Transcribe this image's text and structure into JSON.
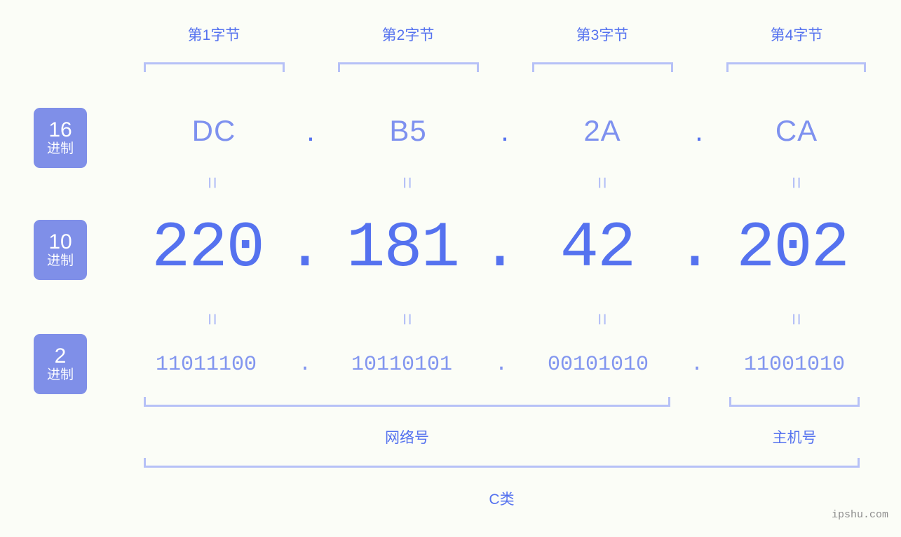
{
  "page": {
    "background_color": "#fbfdf7",
    "accent_color": "#5572ef",
    "accent_light_color": "#b6c1f7",
    "badge_color": "#7f8fe8",
    "watermark": "ipshu.com"
  },
  "byte_headers": [
    {
      "label": "第1字节"
    },
    {
      "label": "第2字节"
    },
    {
      "label": "第3字节"
    },
    {
      "label": "第4字节"
    }
  ],
  "bases": [
    {
      "number": "16",
      "unit": "进制"
    },
    {
      "number": "10",
      "unit": "进制"
    },
    {
      "number": "2",
      "unit": "进制"
    }
  ],
  "separator": ".",
  "equals_mark": "=",
  "rows": {
    "hex": {
      "values": [
        "DC",
        "B5",
        "2A",
        "CA"
      ]
    },
    "decimal": {
      "values": [
        "220",
        "181",
        "42",
        "202"
      ]
    },
    "binary": {
      "values": [
        "11011100",
        "10110101",
        "00101010",
        "11001010"
      ]
    }
  },
  "ip": {
    "decimal_address": "220.181.42.202",
    "hex_address": "DC.B5.2A.CA",
    "binary_address": "11011100.10110101.00101010.11001010"
  },
  "sections": {
    "network_label": "网络号",
    "host_label": "主机号",
    "class_label": "C类"
  }
}
